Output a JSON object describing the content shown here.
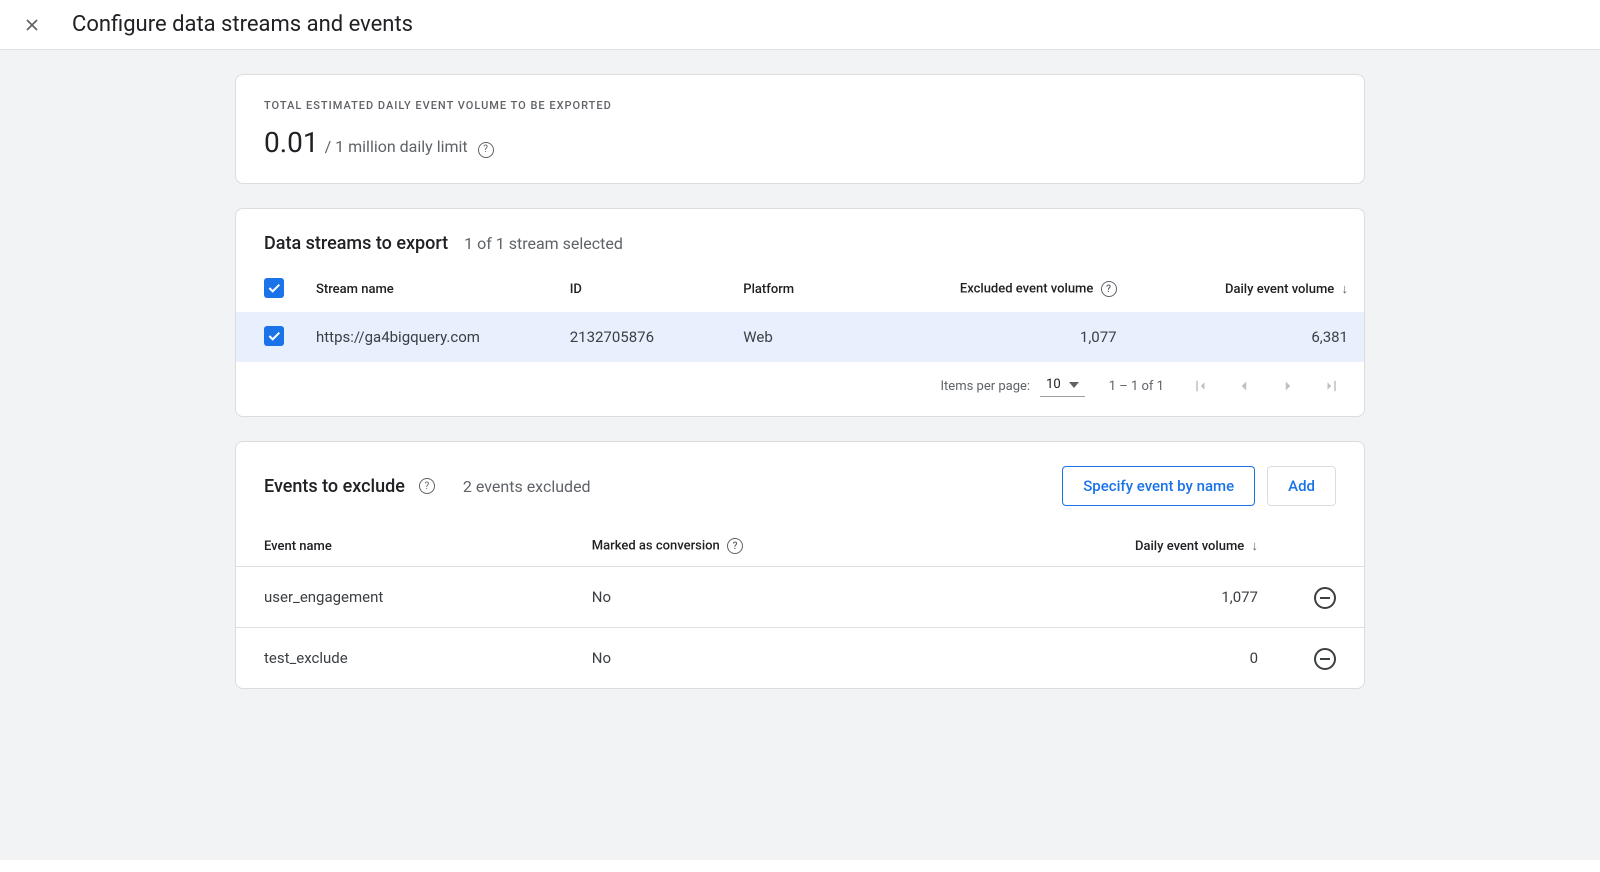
{
  "header": {
    "title": "Configure data streams and events"
  },
  "volumeCard": {
    "label": "TOTAL ESTIMATED DAILY EVENT VOLUME TO BE EXPORTED",
    "value": "0.01",
    "suffix": "/ 1 million daily limit"
  },
  "streams": {
    "title": "Data streams to export",
    "subtitle": "1 of 1 stream selected",
    "columns": {
      "name": "Stream name",
      "id": "ID",
      "platform": "Platform",
      "excluded": "Excluded event volume",
      "daily": "Daily event volume"
    },
    "rows": [
      {
        "name": "https://ga4bigquery.com",
        "id": "2132705876",
        "platform": "Web",
        "excluded": "1,077",
        "daily": "6,381"
      }
    ],
    "pagination": {
      "itemsPerPageLabel": "Items per page:",
      "itemsPerPage": "10",
      "range": "1 – 1 of 1"
    }
  },
  "exclude": {
    "title": "Events to exclude",
    "subtitle": "2 events excluded",
    "specifyButton": "Specify event by name",
    "addButton": "Add",
    "columns": {
      "name": "Event name",
      "conversion": "Marked as conversion",
      "daily": "Daily event volume"
    },
    "rows": [
      {
        "name": "user_engagement",
        "conversion": "No",
        "daily": "1,077"
      },
      {
        "name": "test_exclude",
        "conversion": "No",
        "daily": "0"
      }
    ]
  }
}
